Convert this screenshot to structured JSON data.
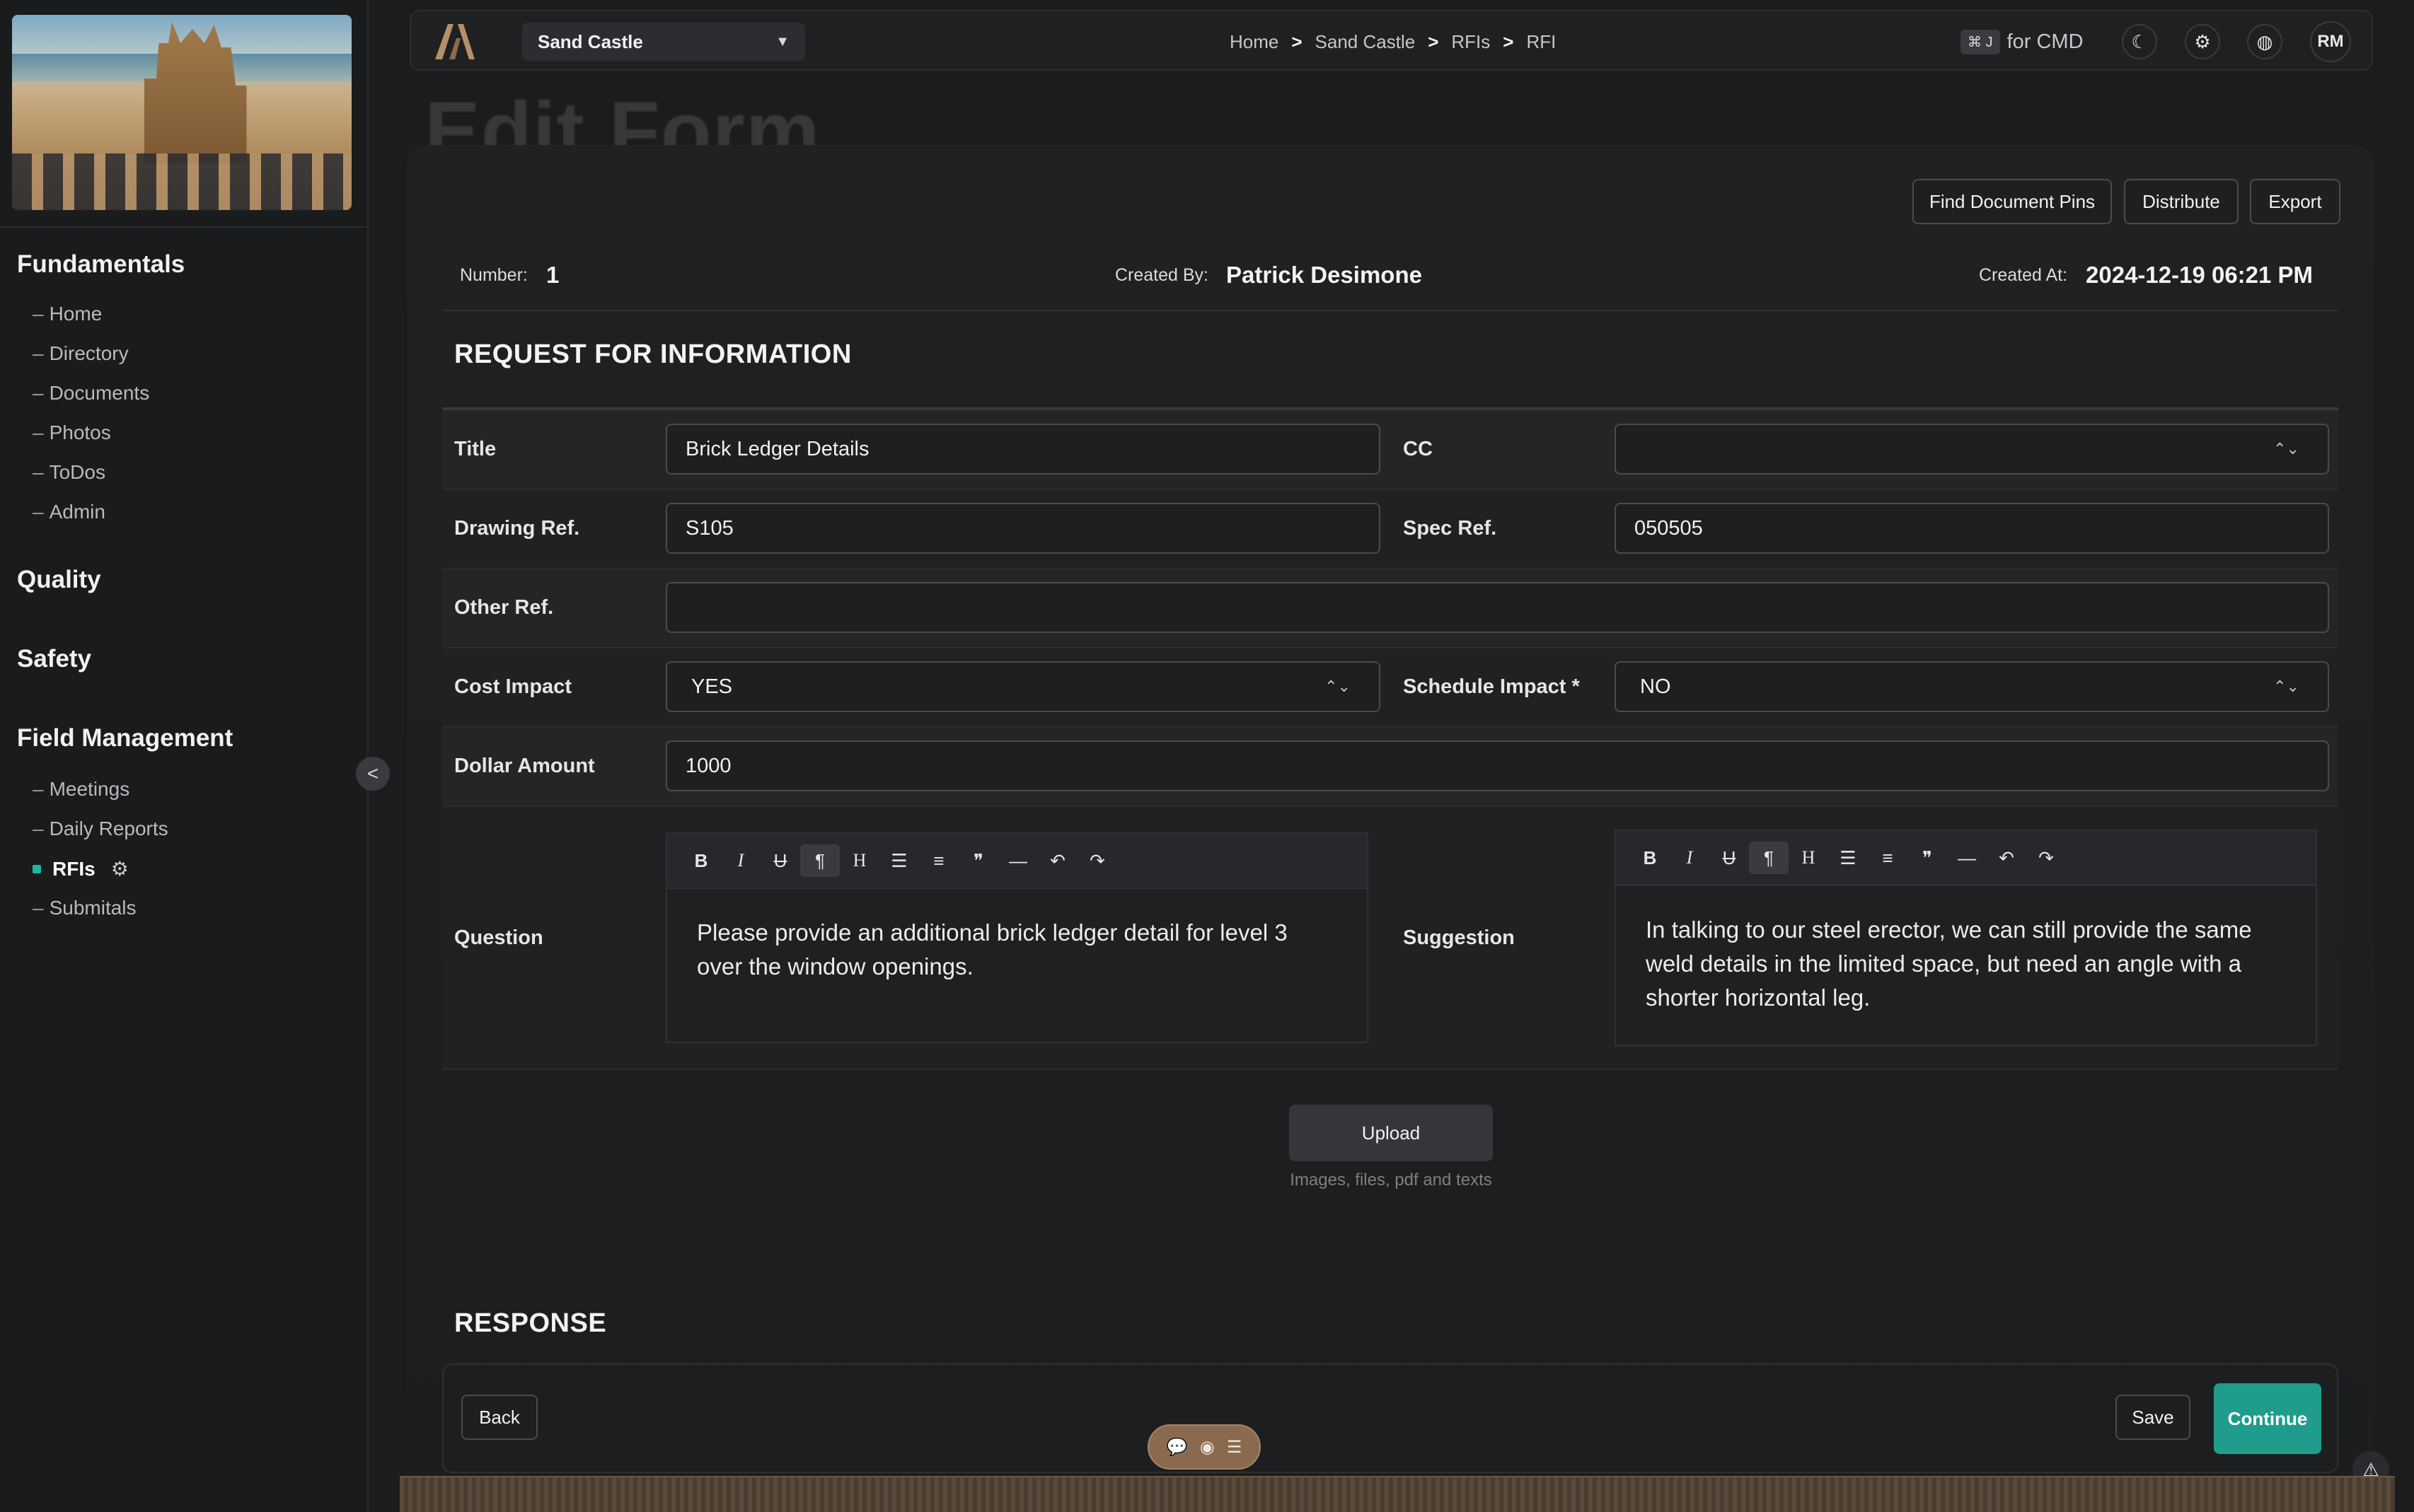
{
  "sidebar": {
    "sections": [
      {
        "title": "Fundamentals",
        "items": [
          "Home",
          "Directory",
          "Documents",
          "Photos",
          "ToDos",
          "Admin"
        ]
      },
      {
        "title": "Quality",
        "items": []
      },
      {
        "title": "Safety",
        "items": []
      },
      {
        "title": "Field Management",
        "items": [
          "Meetings",
          "Daily Reports",
          "RFIs",
          "Submitals"
        ]
      }
    ],
    "active_item": "RFIs",
    "collapse_label": "<"
  },
  "header": {
    "project": "Sand Castle",
    "breadcrumb": [
      "Home",
      "Sand Castle",
      "RFIs",
      "RFI"
    ],
    "breadcrumb_sep": ">",
    "shortcut_key": "⌘ J",
    "shortcut_text": "for CMD",
    "avatar_initials": "RM"
  },
  "page": {
    "title": "Edit Form",
    "actions": {
      "find_pins": "Find Document Pins",
      "distribute": "Distribute",
      "export": "Export"
    },
    "meta": {
      "number_label": "Number:",
      "number": "1",
      "created_by_label": "Created By:",
      "created_by": "Patrick Desimone",
      "created_at_label": "Created At:",
      "created_at": "2024-12-19 06:21 PM"
    }
  },
  "rfi": {
    "heading": "REQUEST FOR INFORMATION",
    "title_label": "Title",
    "title_value": "Brick Ledger Details",
    "cc_label": "CC",
    "cc_value": "",
    "drawing_label": "Drawing Ref.",
    "drawing_value": "S105",
    "spec_label": "Spec Ref.",
    "spec_value": "050505",
    "other_label": "Other Ref.",
    "other_value": "",
    "cost_label": "Cost Impact",
    "cost_value": "YES",
    "schedule_label": "Schedule Impact *",
    "schedule_value": "NO",
    "dollar_label": "Dollar Amount",
    "dollar_value": "1000",
    "question_label": "Question",
    "question_text": "Please provide an additional brick ledger detail for level 3 over the window openings.",
    "suggestion_label": "Suggestion",
    "suggestion_text": "In talking to our steel erector, we can still provide the same weld details in the limited space, but need an angle with a shorter horizontal leg."
  },
  "toolbar_icons": {
    "bold": "B",
    "italic": "I",
    "strike": "U",
    "paragraph": "¶",
    "heading": "H",
    "bullet": "☰",
    "ordered": "≡",
    "quote": "❞",
    "rule": "—",
    "undo": "↶",
    "redo": "↷"
  },
  "upload": {
    "label": "Upload",
    "hint": "Images, files, pdf and texts"
  },
  "response": {
    "heading": "RESPONSE"
  },
  "footer": {
    "back": "Back",
    "save": "Save",
    "continue": "Continue"
  },
  "colors": {
    "accent": "#1f9c8c",
    "active_dot": "#1fb89f",
    "background": "#1b1c1e"
  }
}
